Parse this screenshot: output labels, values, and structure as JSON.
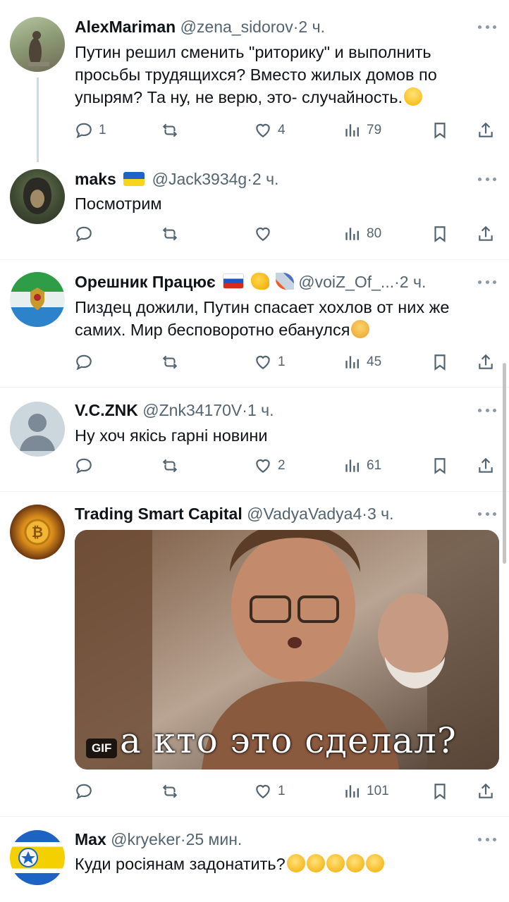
{
  "tweets": [
    {
      "name": "AlexMariman",
      "handle": "@zena_sidorov",
      "time": "2 ч.",
      "text": "Путин решил сменить \"риторику\" и выполнить просьбы трудящихся? Вместо жилых домов по упырям? Та ну, не верю, это- случайность.",
      "replies": "1",
      "retweets": "",
      "likes": "4",
      "views": "79",
      "trailing_emoji": "grinning-face"
    },
    {
      "name": "maks",
      "flag": "ukraine-flag",
      "handle": "@Jack3934g",
      "time": "2 ч.",
      "text": "Посмотрим",
      "replies": "",
      "retweets": "",
      "likes": "",
      "views": "80"
    },
    {
      "name": "Орешник Працює",
      "badges": [
        "russia-flag",
        "flexed-biceps",
        "rocket"
      ],
      "handle": "@voiZ_Of_...",
      "time": "2 ч.",
      "text": "Пиздец дожили, Путин спасает хохлов от них же самих. Мир бесповоротно ебанулся",
      "replies": "",
      "retweets": "",
      "likes": "1",
      "views": "45",
      "trailing_emoji": "facepalm"
    },
    {
      "name": "V.C.ZNK",
      "handle": "@Znk34170V",
      "time": "1 ч.",
      "text": "Ну хоч якісь гарні новини",
      "replies": "",
      "retweets": "",
      "likes": "2",
      "views": "61"
    },
    {
      "name": "Trading Smart Capital",
      "handle": "@VadyaVadya4",
      "time": "3 ч.",
      "text": "",
      "gif_badge": "GIF",
      "gif_caption": "а кто это сделал?",
      "replies": "",
      "retweets": "",
      "likes": "1",
      "views": "101"
    },
    {
      "name": "Max",
      "handle": "@kryeker",
      "time": "25 мин.",
      "text": "Куди росіянам задонатить?",
      "trailing_emoji": "rolling-on-floor-laughing x5"
    }
  ],
  "colors": {
    "secondary": "#536471",
    "divider": "#eff3f4",
    "text": "#0f1419"
  }
}
